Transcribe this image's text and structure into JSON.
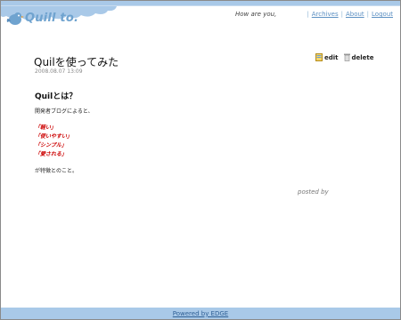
{
  "header": {
    "logo_text": "Quill to.",
    "greeting": "How are you,",
    "nav": [
      {
        "label": "Archives"
      },
      {
        "label": "About"
      },
      {
        "label": "Logout"
      }
    ]
  },
  "post": {
    "title": "Quilを使ってみた",
    "date": "2008.08.07 13:09",
    "edit_label": "edit",
    "delete_label": "delete",
    "section_title": "Quilとは？",
    "intro": "開発者ブログによると、",
    "features": [
      "「軽い」",
      "「使いやすい」",
      "「シンプル」",
      "「愛される」"
    ],
    "outro": "が特徴とのこと。",
    "posted_by": "posted by"
  },
  "footer": {
    "powered_by": "Powered by EDGE"
  },
  "colors": {
    "accent": "#6fa3cf",
    "link": "#5b8fc2",
    "highlight": "#cc0000",
    "footer_bg": "#a9c9e8"
  }
}
